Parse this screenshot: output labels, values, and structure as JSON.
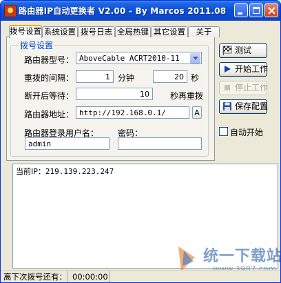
{
  "window": {
    "title": "路由器IP自动更换者 V2.00 - By Marcos 2011.08"
  },
  "tabs": [
    {
      "label": "拨号设置",
      "active": true
    },
    {
      "label": "系统设置"
    },
    {
      "label": "拨号日志"
    },
    {
      "label": "全局热键"
    },
    {
      "label": "其它设置"
    },
    {
      "label": "关于"
    }
  ],
  "dial_group": {
    "title": "拨号设置",
    "router_model_label": "路由器型号：",
    "router_model_value": "AboveCable ACRT2010-11",
    "redial_interval_label": "重拨的间隔：",
    "redial_minutes": "1",
    "minutes_unit": "分钟",
    "redial_seconds": "20",
    "seconds_unit": "秒",
    "wait_after_disconnect_label": "断开后等待：",
    "wait_seconds": "10",
    "wait_unit": "秒再重拨",
    "router_address_label": "路由器地址：",
    "router_address_value": "http://192.168.0.1/",
    "address_button_label": "A",
    "username_label": "路由器登录用户名：",
    "username_value": "admin",
    "password_label": "密码：",
    "password_value": ""
  },
  "actions": {
    "test_label": "测试",
    "start_label": "开始工作",
    "stop_label": "停止工作",
    "save_label": "保存配置",
    "autostart_label": "自动开始",
    "autostart_checked": false
  },
  "log": {
    "current_ip_label": "当前IP：",
    "current_ip_value": "219.139.223.247"
  },
  "status_bar": {
    "next_dial_label": "离下次拨号还有：",
    "next_dial_time": "00:00:00"
  },
  "watermark": {
    "text": "统一下载站",
    "sub": "www.3987.com"
  },
  "colors": {
    "titlebar": "#0a4ed7",
    "group_title": "#0046d5",
    "tab_active_accent": "#f5a623",
    "window_bg": "#ece9d8"
  },
  "icons": {
    "test": "racing-flag-icon",
    "start": "play-icon",
    "stop": "stop-icon",
    "save": "floppy-disk-icon"
  }
}
